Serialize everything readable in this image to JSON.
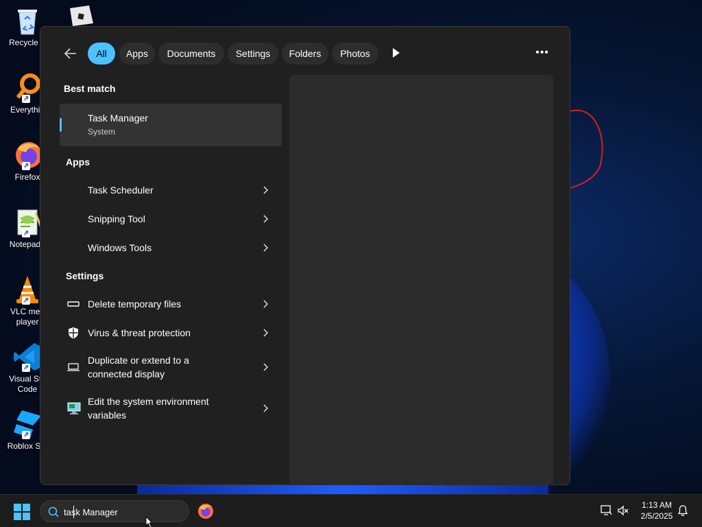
{
  "desktop": {
    "icons": [
      {
        "label": "Recycle B",
        "icon": "recycle-bin-icon"
      },
      {
        "label": "Everythin",
        "icon": "everything-search-icon"
      },
      {
        "label": "Firefox",
        "icon": "firefox-icon"
      },
      {
        "label": "Notepad+",
        "icon": "notepad-plus-icon"
      },
      {
        "label": "VLC med\nplayer",
        "icon": "vlc-icon"
      },
      {
        "label": "Visual Stu\nCode",
        "icon": "vscode-icon"
      },
      {
        "label": "Roblox Stu",
        "icon": "roblox-studio-icon"
      }
    ]
  },
  "search_panel": {
    "filters": [
      "All",
      "Apps",
      "Documents",
      "Settings",
      "Folders",
      "Photos"
    ],
    "active_filter": "All",
    "best_match_heading": "Best match",
    "best_match": {
      "title": "Task Manager",
      "subtitle": "System"
    },
    "apps_heading": "Apps",
    "apps": [
      {
        "title": "Task Scheduler"
      },
      {
        "title": "Snipping Tool"
      },
      {
        "title": "Windows Tools"
      }
    ],
    "settings_heading": "Settings",
    "settings": [
      {
        "title": "Delete temporary files",
        "icon": "storage-icon"
      },
      {
        "title": "Virus & threat protection",
        "icon": "shield-icon"
      },
      {
        "title_line1": "Duplicate or extend to a",
        "title_line2": "connected display",
        "icon": "laptop-display-icon"
      },
      {
        "title_line1": "Edit the system environment",
        "title_line2": "variables",
        "icon": "system-properties-icon"
      }
    ]
  },
  "taskbar": {
    "search_value": "task Manager",
    "clock_time": "1:13 AM",
    "clock_date": "2/5/2025"
  },
  "colors": {
    "accent": "#4cc2ff",
    "panel_bg": "#202020",
    "preview_bg": "#2b2b2b",
    "taskbar_bg": "#1c1c1c"
  }
}
